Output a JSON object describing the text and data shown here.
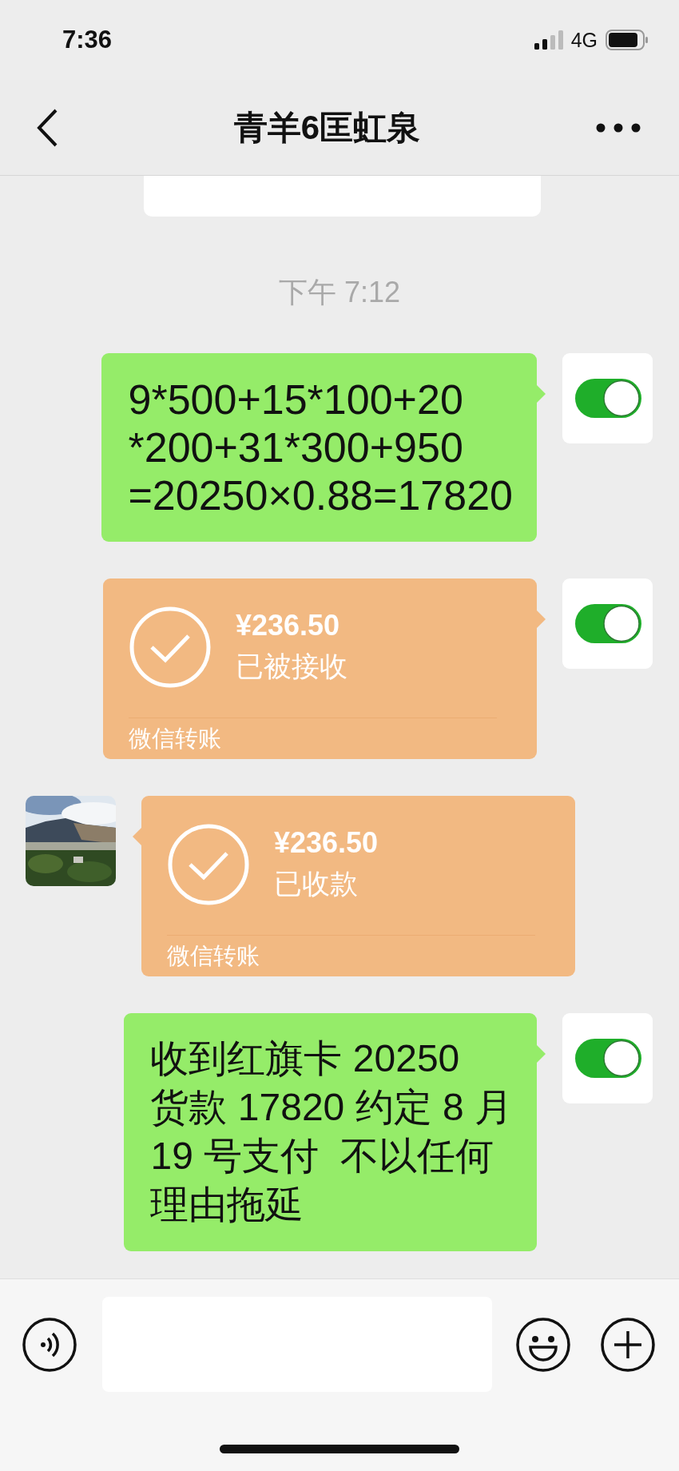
{
  "status_bar": {
    "time": "7:36",
    "network": "4G"
  },
  "header": {
    "title": "青羊6匡虹泉"
  },
  "timestamp": "下午 7:12",
  "messages": [
    {
      "kind": "text",
      "outgoing": true,
      "lines": [
        "9*500+15*100+20",
        "*200+31*300+950",
        "=20250×0.88=17820"
      ]
    },
    {
      "kind": "transfer",
      "outgoing": true,
      "amount": "¥236.50",
      "status": "已被接收",
      "footer": "微信转账"
    },
    {
      "kind": "transfer",
      "outgoing": false,
      "amount": "¥236.50",
      "status": "已收款",
      "footer": "微信转账"
    },
    {
      "kind": "text",
      "outgoing": true,
      "lines": [
        "收到红旗卡 20250",
        "货款 17820 约定 8 月",
        "19 号支付  不以任何",
        "理由拖延"
      ]
    }
  ]
}
